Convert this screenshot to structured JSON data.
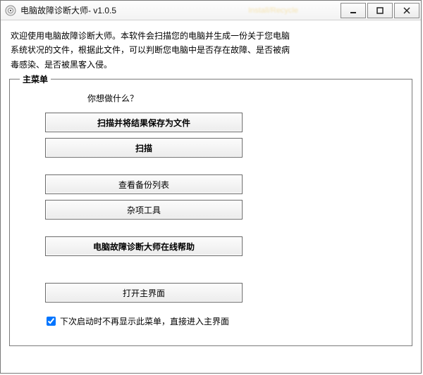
{
  "window": {
    "title": "电脑故障诊断大师- v1.0.5",
    "blurred_mid": "Install/Recycle"
  },
  "intro": {
    "line1": "欢迎使用电脑故障诊断大师。本软件会扫描您的电脑并生成一份关于您电脑",
    "line2": "系统状况的文件，根据此文件，可以判断您电脑中是否存在故障、是否被病",
    "line3": "毒感染、是否被黑客入侵。"
  },
  "menu": {
    "legend": "主菜单",
    "prompt": "你想做什么？",
    "btn_scan_save": "扫描并将结果保存为文件",
    "btn_scan": "扫描",
    "btn_backup_list": "查看备份列表",
    "btn_misc_tools": "杂项工具",
    "btn_online_help": "电脑故障诊断大师在线帮助",
    "btn_open_main": "打开主界面",
    "checkbox_label": "下次启动时不再显示此菜单，直接进入主界面",
    "checkbox_checked": true
  }
}
